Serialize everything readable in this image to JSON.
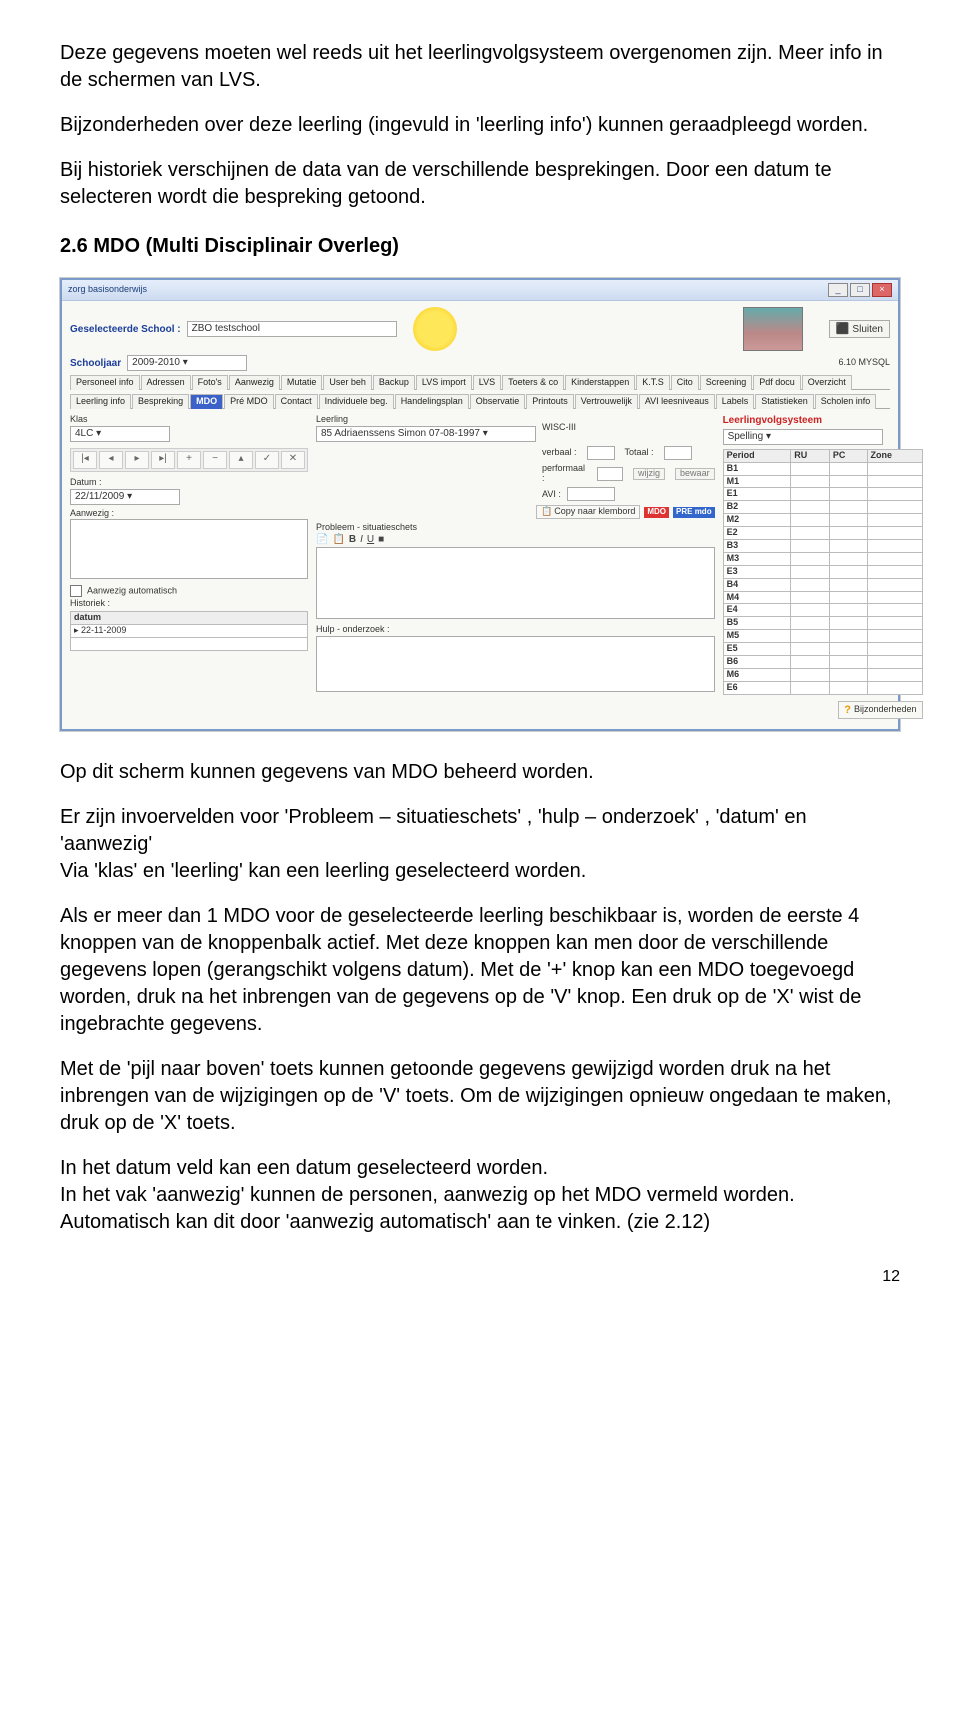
{
  "paragraphs": {
    "p1": "Deze gegevens moeten wel reeds uit het leerlingvolgsysteem overgenomen zijn. Meer info in de schermen van LVS.",
    "p2": "Bijzonderheden over deze leerling (ingevuld in 'leerling info') kunnen geraadpleegd worden.",
    "p3": "Bij historiek verschijnen de data van de verschillende besprekingen. Door een datum te selecteren wordt die bespreking getoond."
  },
  "heading": "2.6 MDO (Multi Disciplinair Overleg)",
  "body": {
    "b1": "Op  dit scherm kunnen gegevens van MDO beheerd worden.",
    "b2": "Er zijn invoervelden voor 'Probleem – situatieschets' , 'hulp – onderzoek' , 'datum' en 'aanwezig'",
    "b3": "Via 'klas' en 'leerling' kan een leerling geselecteerd worden.",
    "b4": "Als er meer dan 1 MDO voor de geselecteerde leerling beschikbaar is, worden de eerste 4 knoppen van de knoppenbalk actief. Met deze knoppen kan men door de verschillende gegevens lopen (gerangschikt volgens datum). Met de '+' knop kan een MDO toegevoegd worden, druk na het inbrengen van de gegevens op de 'V' knop. Een druk op de 'X' wist de ingebrachte gegevens.",
    "b5": "Met de 'pijl naar boven' toets kunnen getoonde gegevens gewijzigd worden druk na het inbrengen van de wijzigingen op de 'V' toets. Om de wijzigingen opnieuw ongedaan te maken, druk op de 'X' toets.",
    "b6": "In het datum veld kan een datum geselecteerd worden.",
    "b7": "In het vak 'aanwezig' kunnen de personen, aanwezig op het MDO vermeld worden. Automatisch kan dit door 'aanwezig automatisch' aan te vinken. (zie 2.12)"
  },
  "page_number": "12",
  "app": {
    "titlebar": "zorg basisonderwijs",
    "school_label": "Geselecteerde School :",
    "school_value": "ZBO testschool",
    "year_label": "Schooljaar",
    "year_value": "2009-2010",
    "version": "6.10 MYSQL",
    "sluiten": "Sluiten",
    "tabs_top": [
      "Personeel info",
      "Adressen",
      "Foto's",
      "Aanwezig",
      "Mutatie",
      "User beh",
      "Backup",
      "LVS import",
      "LVS",
      "Toeters & co",
      "Kinderstappen",
      "K.T.S",
      "Cito",
      "Screening",
      "Pdf docu",
      "Overzicht"
    ],
    "tabs_bottom": [
      "Leerling info",
      "Bespreking",
      "MDO",
      "Pré MDO",
      "Contact",
      "Individuele beg.",
      "Handelingsplan",
      "Observatie",
      "Printouts",
      "Vertrouwelijk",
      "AVI leesniveaus",
      "Labels",
      "Statistieken",
      "Scholen info"
    ],
    "klas_label": "Klas",
    "klas_value": "4LC",
    "leerling_label": "Leerling",
    "leerling_value": "85    Adriaenssens Simon 07-08-1997",
    "wisc_label": "WISC-III",
    "verbaal_label": "verbaal :",
    "performaal_label": "performaal :",
    "totaal_label": "Totaal :",
    "avi_label": "AVI :",
    "wijzig_btn": "wijzig",
    "bewaar_btn": "bewaar",
    "navbtns": [
      "|◂",
      "◂",
      "▸",
      "▸|",
      "+",
      "−",
      "▴",
      "✓",
      "✕"
    ],
    "copy_label": "Copy naar klembord",
    "badge_mdo": "MDO",
    "badge_pre": "PRE mdo",
    "rich_labels": [
      "B",
      "I",
      "U"
    ],
    "datum_label": "Datum :",
    "datum_value": "22/11/2009",
    "aanwezig_label": "Aanwezig :",
    "aanwezig_auto_label": "Aanwezig automatisch",
    "historiek_label": "Historiek :",
    "hist_col": "datum",
    "hist_row": "22-11-2009",
    "probleem_label": "Probleem - situatieschets",
    "hulp_label": "Hulp - onderzoek :",
    "lvs_title": "Leerlingvolgsysteem",
    "lvs_dropdown": "Spelling",
    "lvs_cols": [
      "Period",
      "RU",
      "PC",
      "Zone"
    ],
    "lvs_rows": [
      "B1",
      "M1",
      "E1",
      "B2",
      "M2",
      "E2",
      "B3",
      "M3",
      "E3",
      "B4",
      "M4",
      "E4",
      "B5",
      "M5",
      "E5",
      "B6",
      "M6",
      "E6"
    ],
    "bijz_btn": "Bijzonderheden"
  }
}
